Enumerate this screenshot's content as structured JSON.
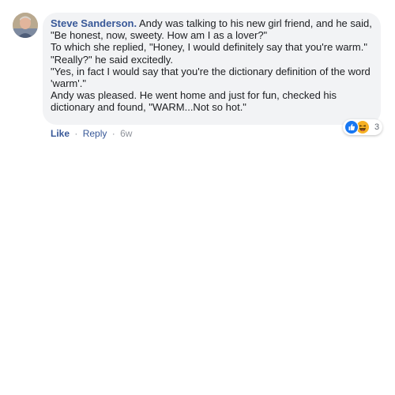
{
  "comment": {
    "author": "Steve Sanderson.",
    "lines": [
      "Andy was talking to his new girl friend, and he said,",
      "\"Be honest, now, sweety. How am I as a lover?\"",
      "To which she replied, \"Honey, I would definitely say that you're warm.\"",
      "\"Really?\" he said excitedly.",
      "\"Yes, in fact I would say that you're the dictionary definition of the word",
      "'warm'.\"",
      "Andy was pleased. He went home and just for fun, checked his",
      "dictionary and found, \"WARM...Not so hot.\""
    ],
    "reactions": {
      "icons": [
        "like-icon",
        "haha-icon"
      ],
      "count": "3"
    },
    "actions": {
      "like": "Like",
      "reply": "Reply",
      "time": "6w",
      "separator": "·"
    }
  },
  "colors": {
    "link": "#385898",
    "bubble": "#f2f3f5",
    "text": "#1c1e21",
    "meta": "#90949c",
    "like_blue": "#1877f2",
    "haha_yellow": "#f7b125"
  }
}
